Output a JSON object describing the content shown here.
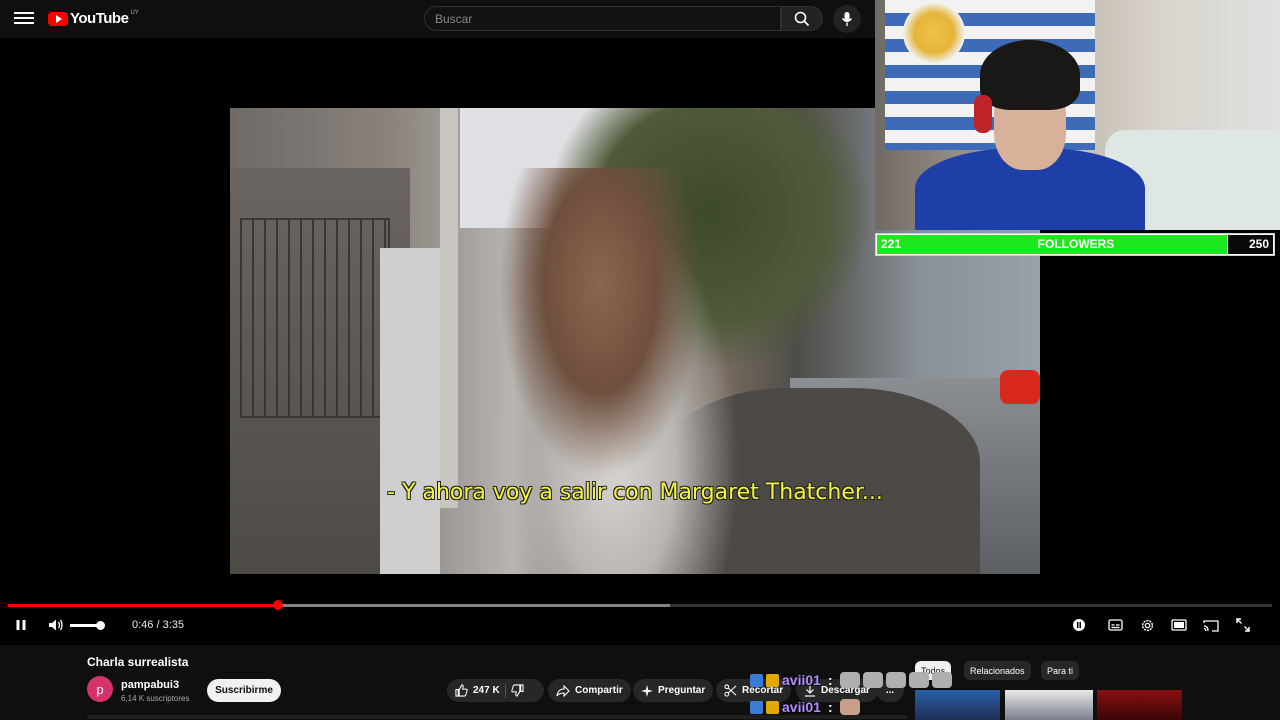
{
  "header": {
    "logo_text": "YouTube",
    "region": "UY",
    "search_placeholder": "Buscar"
  },
  "video": {
    "subtitle": "- Y ahora voy a salir con Margaret Thatcher...",
    "progress_played_fraction": 0.214,
    "progress_buffered_fraction": 0.524,
    "time_display": "0:46 / 3:35",
    "volume_fraction": 0.9
  },
  "stream_overlay": {
    "followers_current": "221",
    "followers_label": "FOLLOWERS",
    "followers_goal": "250",
    "followers_fill_fraction": 0.884,
    "fill_color": "#1de81d"
  },
  "below_video": {
    "title": "Charla surrealista",
    "channel_initial": "p",
    "channel_name": "pampabui3",
    "subscribers": "6,14 K suscriptores",
    "subscribe_label": "Suscribirme",
    "like_count": "247 K",
    "share_label": "Compartir",
    "ask_label": "Preguntar",
    "clip_label": "Recortar",
    "download_label": "Descargar",
    "more_label": "...",
    "filter_chips": [
      "Todos",
      "Relacionados",
      "Para ti"
    ]
  },
  "chat": [
    {
      "user": "avii01",
      "colon": ":",
      "emote_count": 5
    },
    {
      "user": "avii01",
      "colon": ":",
      "emote_count": 1
    }
  ],
  "colors": {
    "accent": "#ff0000",
    "background": "#0f0f0f",
    "chat_user": "#b38cff"
  },
  "icons": [
    "menu-icon",
    "youtube-logo-icon",
    "search-icon",
    "microphone-icon",
    "pause-icon",
    "volume-icon",
    "autoplay-toggle-icon",
    "subtitles-icon",
    "settings-gear-icon",
    "theater-mode-icon",
    "cast-icon",
    "fullscreen-icon",
    "like-icon",
    "dislike-icon",
    "share-icon",
    "sparkle-icon",
    "scissors-icon",
    "download-icon"
  ]
}
